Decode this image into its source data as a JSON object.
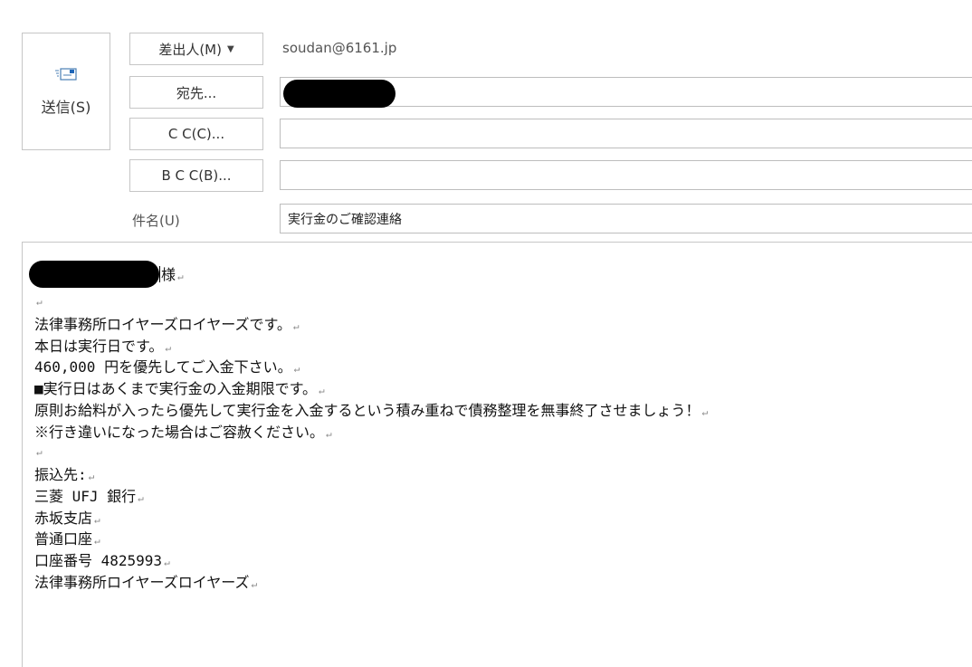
{
  "compose": {
    "send_label": "送信(S)",
    "from_button": "差出人(M)",
    "from_value": "soudan@6161.jp",
    "to_button": "宛先...",
    "cc_button": "C C(C)...",
    "bcc_button": "B C C(B)...",
    "subject_label": "件名(U)",
    "subject_value": "実行金のご確認連絡",
    "cc_value": "",
    "bcc_value": ""
  },
  "body": {
    "greeting_suffix": "様",
    "lines": [
      "",
      "法律事務所ロイヤーズロイヤーズです。",
      "本日は実行日です。",
      "460,000 円を優先してご入金下さい。",
      "■実行日はあくまで実行金の入金期限です。",
      "原則お給料が入ったら優先して実行金を入金するという積み重ねで債務整理を無事終了させましょう！",
      "※行き違いになった場合はご容赦ください。",
      "",
      "振込先:",
      "三菱 UFJ 銀行",
      "赤坂支店",
      "普通口座",
      "口座番号 4825993",
      "法律事務所ロイヤーズロイヤーズ"
    ],
    "return_mark": "↵"
  },
  "icons": {
    "send": "send-mail-icon",
    "dropdown": "chevron-down-icon"
  }
}
